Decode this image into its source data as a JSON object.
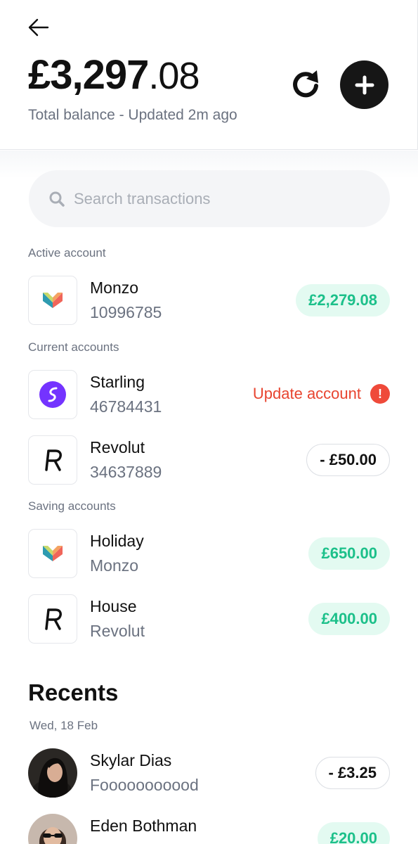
{
  "header": {
    "balance_whole": "£3,297",
    "balance_pence": ".08",
    "balance_subtitle": "Total balance - Updated 2m ago"
  },
  "search": {
    "placeholder": "Search transactions"
  },
  "sections": {
    "active": "Active account",
    "current": "Current accounts",
    "saving": "Saving accounts"
  },
  "accounts": [
    {
      "name": "Monzo",
      "detail": "10996785",
      "amount": "£2,279.08",
      "logo": "monzo-logo"
    },
    {
      "name": "Starling",
      "detail": "46784431",
      "action": "Update account",
      "alert_glyph": "!",
      "logo": "starling-logo"
    },
    {
      "name": "Revolut",
      "detail": "34637889",
      "amount": "- £50.00",
      "logo": "revolut-logo"
    },
    {
      "name": "Holiday",
      "detail": "Monzo",
      "amount": "£650.00",
      "logo": "monzo-logo"
    },
    {
      "name": "House",
      "detail": "Revolut",
      "amount": "£400.00",
      "logo": "revolut-logo"
    }
  ],
  "recents": {
    "title": "Recents",
    "date": "Wed, 18 Feb",
    "items": [
      {
        "name": "Skylar Dias",
        "detail": "Fooooooooood",
        "amount": "- £3.25"
      },
      {
        "name": "Eden Bothman",
        "detail": "",
        "amount": "£20.00"
      }
    ]
  },
  "colors": {
    "positive": "#1cc08a",
    "positive_bg": "#e3faf1",
    "alert": "#e8442f",
    "starling": "#7433ff"
  }
}
